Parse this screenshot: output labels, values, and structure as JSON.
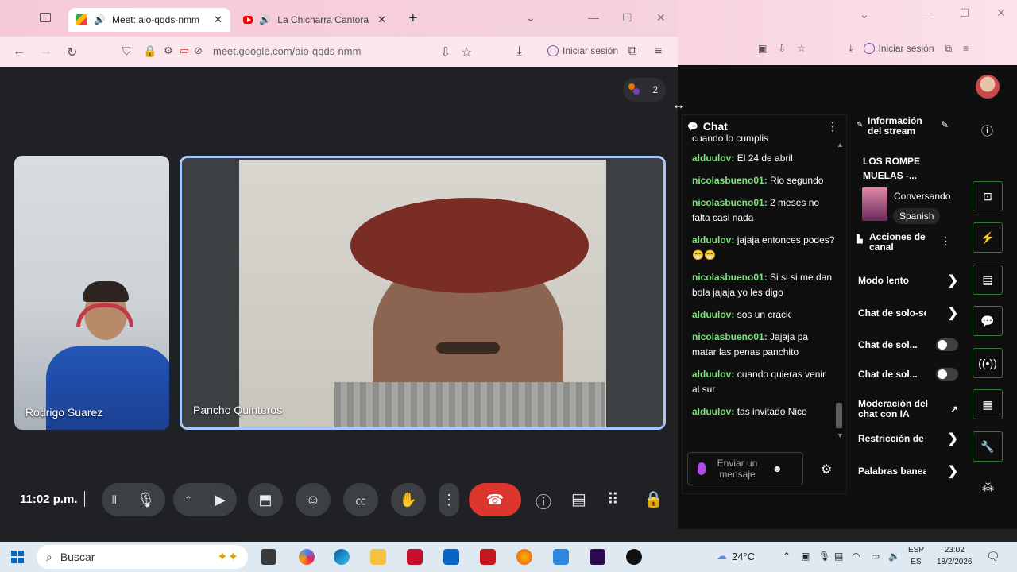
{
  "browser": {
    "tabs": [
      {
        "title": "Meet: aio-qqds-nmm",
        "icon": "google-meet-icon",
        "active": true
      },
      {
        "title": "La Chicharra Cantora - You",
        "icon": "youtube-icon",
        "active": false
      }
    ],
    "url": "meet.google.com/aio-qqds-nmm",
    "signin_label": "Iniciar sesión"
  },
  "background_window": {
    "signin_label": "Iniciar sesión"
  },
  "meet": {
    "participant_count": "2",
    "tiles": [
      {
        "name": "Rodrigo Suarez"
      },
      {
        "name": "Pancho Quinteros"
      }
    ],
    "clock": "11:02 p.m."
  },
  "chat": {
    "title": "Chat",
    "partial_top": "cuando lo cumplis",
    "messages": [
      {
        "author": "alduulov:",
        "text": "El 24 de abril"
      },
      {
        "author": "nicolasbueno01:",
        "text": "Rio segundo"
      },
      {
        "author": "nicolasbueno01:",
        "text": "2 meses no falta casi nada"
      },
      {
        "author": "alduulov:",
        "text": "jajaja entonces podes? 😁😁"
      },
      {
        "author": "nicolasbueno01:",
        "text": "Si si si me dan bola jajaja yo les digo"
      },
      {
        "author": "alduulov:",
        "text": "sos un crack"
      },
      {
        "author": "nicolasbueno01:",
        "text": "Jajaja pa matar las penas panchito"
      },
      {
        "author": "alduulov:",
        "text": "cuando quieras venir al sur"
      },
      {
        "author": "alduulov:",
        "text": "tas invitado Nico"
      }
    ],
    "input_placeholder": "Enviar un mensaje"
  },
  "stream_info": {
    "title": "Información del stream",
    "stream_title": "LOS ROMPE MUELAS -...",
    "category": "Conversando",
    "language": "Spanish"
  },
  "channel_actions": {
    "title": "Acciones de canal",
    "items": [
      {
        "label": "Modo lento",
        "control": "arrow"
      },
      {
        "label": "Chat de solo-se",
        "control": "arrow"
      },
      {
        "label": "Chat de sol...",
        "control": "toggle",
        "on": false
      },
      {
        "label": "Chat de sol...",
        "control": "toggle",
        "on": false
      },
      {
        "label": "Moderación del chat con IA",
        "control": "external"
      },
      {
        "label": "Restricción de c",
        "control": "arrow"
      },
      {
        "label": "Palabras banea",
        "control": "arrow"
      }
    ]
  },
  "rail_icons": [
    "info-icon",
    "screenshot-icon",
    "lightning-icon",
    "notes-icon",
    "chat-bubble-icon",
    "broadcast-icon",
    "layout-icon",
    "wrench-icon",
    "users-icon"
  ],
  "taskbar": {
    "search_placeholder": "Buscar",
    "weather": "24°C",
    "lang_top": "ESP",
    "lang_bottom": "ES",
    "time": "23:02",
    "date": "18/2/2026"
  },
  "colors": {
    "meet_bg": "#202124",
    "hangup": "#dc362e",
    "chat_author": "#7ce07c",
    "active_tile_border": "#a8c7fa",
    "rail_border": "#2e7d32"
  }
}
